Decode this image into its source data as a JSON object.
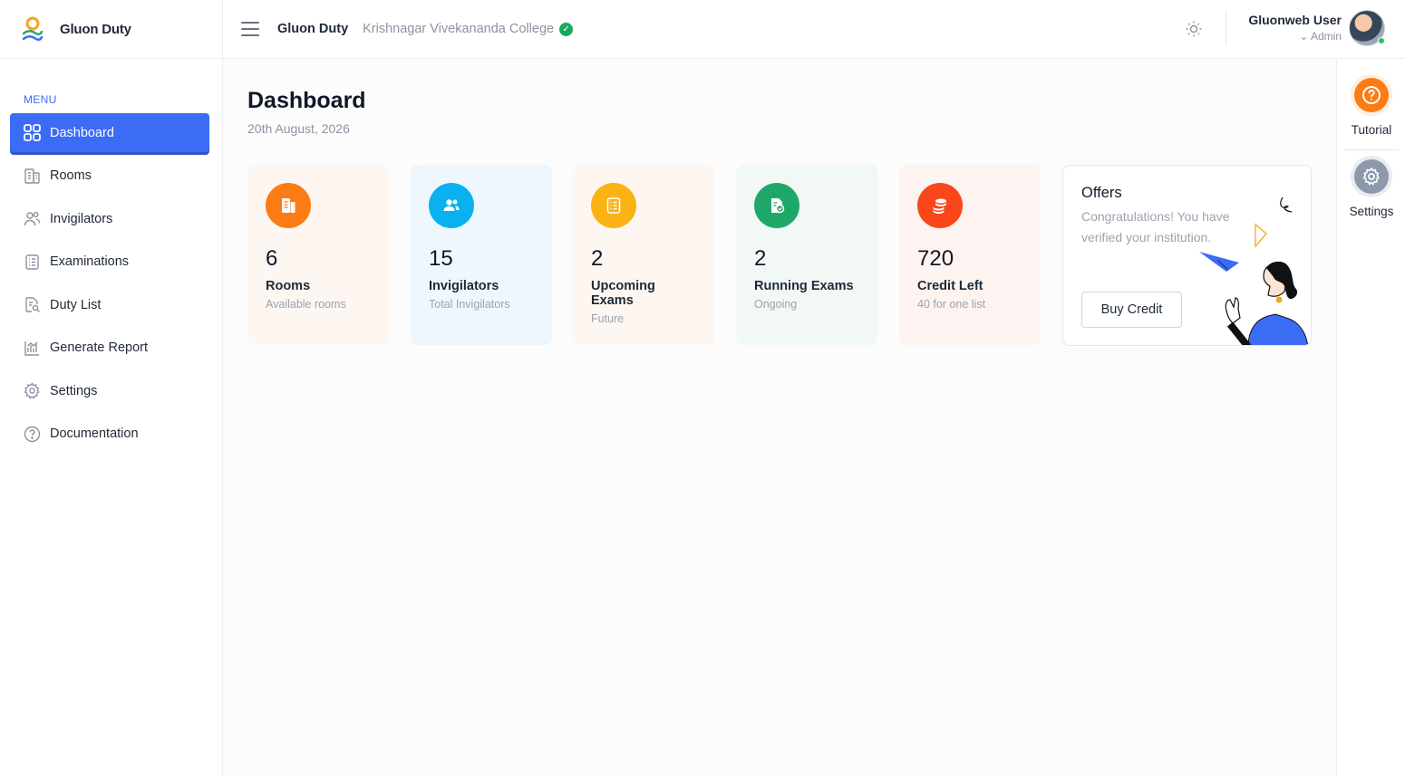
{
  "brand": {
    "name": "Gluon Duty",
    "icon": "gluon-logo-icon"
  },
  "sidebar": {
    "menu_title": "MENU",
    "items": [
      {
        "label": "Dashboard",
        "icon": "grid-icon",
        "active": true
      },
      {
        "label": "Rooms",
        "icon": "building-icon"
      },
      {
        "label": "Invigilators",
        "icon": "users-icon"
      },
      {
        "label": "Examinations",
        "icon": "clipboard-icon"
      },
      {
        "label": "Duty List",
        "icon": "document-search-icon"
      },
      {
        "label": "Generate Report",
        "icon": "bar-chart-icon"
      },
      {
        "label": "Settings",
        "icon": "gear-icon"
      },
      {
        "label": "Documentation",
        "icon": "help-circle-icon"
      }
    ]
  },
  "header": {
    "app_name": "Gluon Duty",
    "college": "Krishnagar Vivekananda College",
    "verified_icon": "verified-check-icon",
    "user_name": "Gluonweb User",
    "user_role": "Admin"
  },
  "main": {
    "title": "Dashboard",
    "date": "20th August, 2026",
    "cards": [
      {
        "value": "6",
        "label": "Rooms",
        "sub": "Available rooms",
        "icon": "building-icon",
        "color": "#fb7c14",
        "bg": "#fdf6f1"
      },
      {
        "value": "15",
        "label": "Invigilators",
        "sub": "Total Invigilators",
        "icon": "users-icon",
        "color": "#0ab1ef",
        "bg": "#eef7fd"
      },
      {
        "value": "2",
        "label": "Upcoming Exams",
        "sub": "Future",
        "icon": "clipboard-icon",
        "color": "#fbb215",
        "bg": "#fdf6f1"
      },
      {
        "value": "2",
        "label": "Running Exams",
        "sub": "Ongoing",
        "icon": "document-check-icon",
        "color": "#1fa769",
        "bg": "#f1f8f5"
      },
      {
        "value": "720",
        "label": "Credit Left",
        "sub": "40 for one list",
        "icon": "coins-icon",
        "color": "#f9461b",
        "bg": "#fdf3f0"
      }
    ],
    "offers": {
      "title": "Offers",
      "text": "Congratulations! You have verified your institution.",
      "button": "Buy Credit",
      "illustration": "woman-paper-plane-illustration"
    }
  },
  "rail": {
    "tutorial": {
      "label": "Tutorial",
      "icon": "question-icon",
      "color": "#fb7c14"
    },
    "settings": {
      "label": "Settings",
      "icon": "gear-icon",
      "color": "#8d99ab"
    }
  }
}
